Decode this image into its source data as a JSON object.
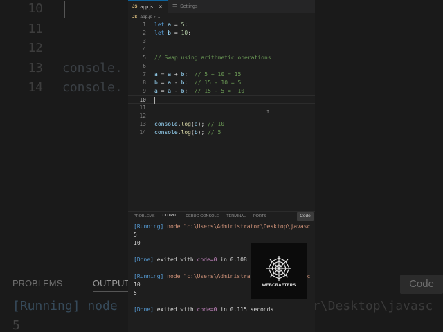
{
  "tabs": [
    {
      "label": "app.js",
      "icon": "js-icon"
    },
    {
      "label": "Settings",
      "icon": "gear-icon"
    }
  ],
  "breadcrumb": {
    "file": "app.js",
    "rest": "..."
  },
  "editor": {
    "lines": [
      {
        "n": "1",
        "tokens": [
          [
            "kw",
            "let"
          ],
          [
            "op",
            " "
          ],
          [
            "var",
            "a"
          ],
          [
            "op",
            " = "
          ],
          [
            "num",
            "5"
          ],
          [
            "op",
            ";"
          ]
        ]
      },
      {
        "n": "2",
        "tokens": [
          [
            "kw",
            "let"
          ],
          [
            "op",
            " "
          ],
          [
            "var",
            "b"
          ],
          [
            "op",
            " = "
          ],
          [
            "num",
            "10"
          ],
          [
            "op",
            ";"
          ]
        ]
      },
      {
        "n": "3",
        "tokens": []
      },
      {
        "n": "4",
        "tokens": []
      },
      {
        "n": "5",
        "tokens": [
          [
            "cm",
            "// Swap using arithmetic operations"
          ]
        ]
      },
      {
        "n": "6",
        "tokens": []
      },
      {
        "n": "7",
        "tokens": [
          [
            "var",
            "a"
          ],
          [
            "op",
            " = "
          ],
          [
            "var",
            "a"
          ],
          [
            "op",
            " + "
          ],
          [
            "var",
            "b"
          ],
          [
            "op",
            ";  "
          ],
          [
            "cm",
            "// 5 + 10 = 15"
          ]
        ]
      },
      {
        "n": "8",
        "tokens": [
          [
            "var",
            "b"
          ],
          [
            "op",
            " = "
          ],
          [
            "var",
            "a"
          ],
          [
            "op",
            " - "
          ],
          [
            "var",
            "b"
          ],
          [
            "op",
            ";  "
          ],
          [
            "cm",
            "// 15 - 10 = 5"
          ]
        ]
      },
      {
        "n": "9",
        "tokens": [
          [
            "var",
            "a"
          ],
          [
            "op",
            " = "
          ],
          [
            "var",
            "a"
          ],
          [
            "op",
            " - "
          ],
          [
            "var",
            "b"
          ],
          [
            "op",
            ";  "
          ],
          [
            "cm",
            "// 15 - 5 =  10"
          ]
        ]
      },
      {
        "n": "10",
        "tokens": [],
        "current": true
      },
      {
        "n": "11",
        "tokens": []
      },
      {
        "n": "12",
        "tokens": []
      },
      {
        "n": "13",
        "tokens": [
          [
            "var",
            "console"
          ],
          [
            "op",
            "."
          ],
          [
            "fn",
            "log"
          ],
          [
            "op",
            "("
          ],
          [
            "var",
            "a"
          ],
          [
            "op",
            "); "
          ],
          [
            "cm",
            "// 10"
          ]
        ]
      },
      {
        "n": "14",
        "tokens": [
          [
            "var",
            "console"
          ],
          [
            "op",
            "."
          ],
          [
            "fn",
            "log"
          ],
          [
            "op",
            "("
          ],
          [
            "var",
            "b"
          ],
          [
            "op",
            "); "
          ],
          [
            "cm",
            "// 5"
          ]
        ]
      }
    ]
  },
  "panel": {
    "tabs": [
      "PROBLEMS",
      "OUTPUT",
      "DEBUG CONSOLE",
      "TERMINAL",
      "PORTS"
    ],
    "active_tab": "OUTPUT",
    "code_button": "Code",
    "output": [
      {
        "type": "run",
        "tag": "[Running]",
        "text": " node \"c:\\Users\\Administrator\\Desktop\\javasc"
      },
      {
        "type": "plain",
        "text": "5"
      },
      {
        "type": "plain",
        "text": "10"
      },
      {
        "type": "blank",
        "text": ""
      },
      {
        "type": "done",
        "tag": "[Done]",
        "text": " exited with ",
        "code": "code=0",
        "tail": " in 0.108"
      },
      {
        "type": "blank",
        "text": ""
      },
      {
        "type": "run",
        "tag": "[Running]",
        "text": " node \"c:\\Users\\Administrator\\Desktop\\javasc"
      },
      {
        "type": "plain",
        "text": "10"
      },
      {
        "type": "plain",
        "text": "5"
      },
      {
        "type": "blank",
        "text": ""
      },
      {
        "type": "done",
        "tag": "[Done]",
        "text": " exited with ",
        "code": "code=0",
        "tail": " in 0.115 seconds"
      }
    ]
  },
  "logo": {
    "text": "WEBCRAFTERS"
  },
  "background": {
    "lines": [
      {
        "n": "10",
        "code": ""
      },
      {
        "n": "11",
        "code": ""
      },
      {
        "n": "12",
        "code": ""
      },
      {
        "n": "13",
        "code": "console."
      },
      {
        "n": "14",
        "code": "console."
      }
    ],
    "tabs": [
      "PROBLEMS",
      "OUTPUT"
    ],
    "code_button": "Code",
    "run_text": "[Running] node",
    "desk_text": "r\\Desktop\\javasc",
    "five": "5"
  }
}
